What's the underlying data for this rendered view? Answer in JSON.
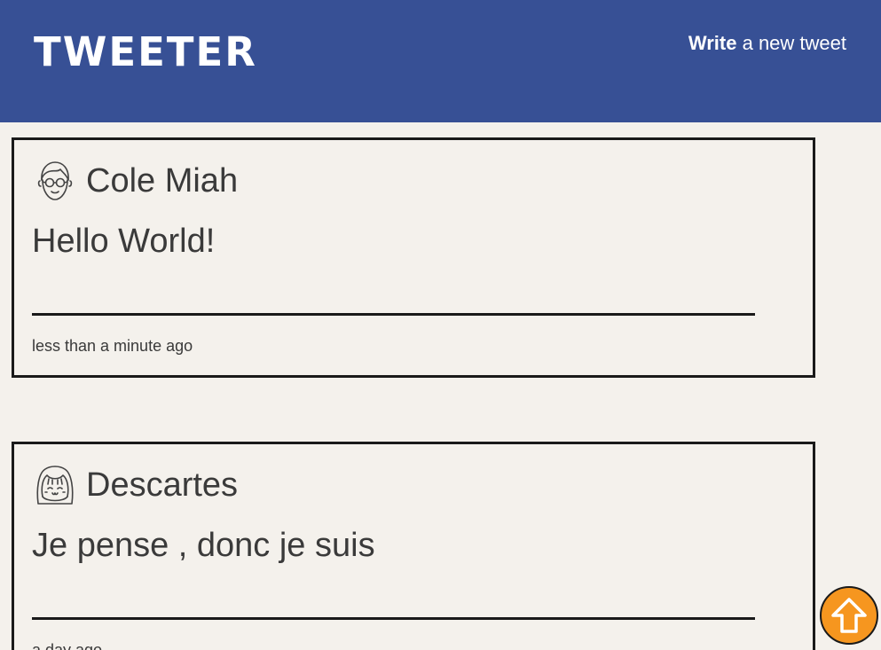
{
  "header": {
    "brand": "TWEETER",
    "compose_bold": "Write",
    "compose_rest": " a new tweet"
  },
  "tweets": [
    {
      "author": "Cole Miah",
      "avatar_icon": "boy-with-glasses-avatar-icon",
      "content": "Hello World!",
      "timestamp": "less than a minute ago"
    },
    {
      "author": "Descartes",
      "avatar_icon": "girl-avatar-icon",
      "content": "Je pense , donc je suis",
      "timestamp": "a day ago"
    }
  ],
  "scroll_top": {
    "icon": "up-arrow-icon",
    "color": "#f6961f"
  },
  "colors": {
    "navbar": "#375095",
    "background": "#f4f1ec",
    "text": "#3a3a3a",
    "border": "#1a1a1a"
  }
}
